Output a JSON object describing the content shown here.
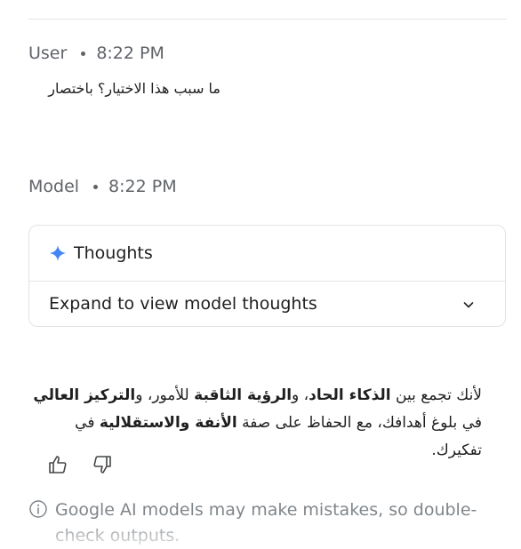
{
  "user_turn": {
    "author": "User",
    "time": "8:22 PM",
    "text": "ما سبب هذا الاختيار؟ باختصار"
  },
  "model_turn": {
    "author": "Model",
    "time": "8:22 PM",
    "thoughts": {
      "title": "Thoughts",
      "expand_label": "Expand to view model thoughts",
      "icon": "sparkle-icon",
      "accent": "#4285f4"
    },
    "response": {
      "segments": [
        {
          "text": "لأنك تجمع بين ",
          "bold": false
        },
        {
          "text": "الذكاء الحاد",
          "bold": true
        },
        {
          "text": "، و",
          "bold": false
        },
        {
          "text": "الرؤية الثاقبة",
          "bold": true
        },
        {
          "text": " للأمور، و",
          "bold": false
        },
        {
          "text": "التركيز العالي",
          "bold": true
        },
        {
          "text": " في بلوغ أهدافك، مع الحفاظ على صفة ",
          "bold": false
        },
        {
          "text": "الأنفة والاستقلالية",
          "bold": true
        },
        {
          "text": " في تفكيرك.",
          "bold": false
        }
      ]
    },
    "feedback": {
      "like_icon": "thumb-up-icon",
      "dislike_icon": "thumb-down-icon"
    }
  },
  "disclaimer": "Google AI models may make mistakes, so double-check outputs."
}
